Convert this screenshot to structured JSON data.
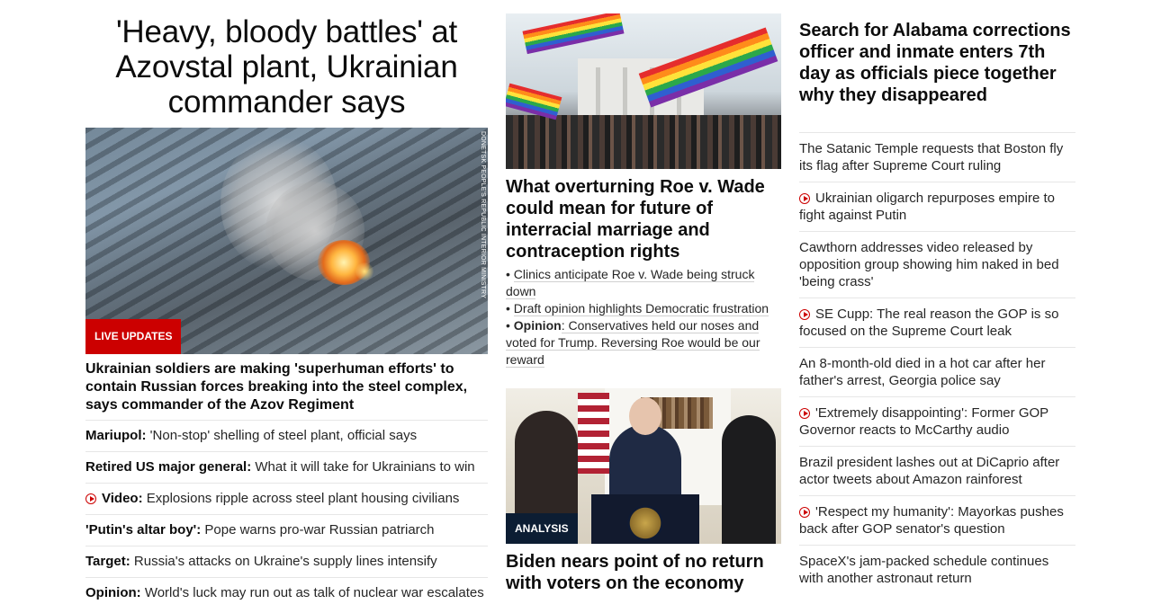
{
  "left": {
    "main_headline": "'Heavy, bloody battles' at Azovstal plant, Ukrainian commander says",
    "image_credit": "DONETSK PEOPLE'S REPUBLIC INTERIOR MINISTRY",
    "badge": "LIVE UPDATES",
    "card_title": "Ukrainian soldiers are making 'superhuman efforts' to contain Russian forces breaking into the steel complex, says commander of the Azov Regiment",
    "items": [
      {
        "bold": "Mariupol:",
        "text": " 'Non-stop' shelling of steel plant, official says",
        "video": false
      },
      {
        "bold": "Retired US major general:",
        "text": " What it will take for Ukrainians to win",
        "video": false
      },
      {
        "bold": "Video:",
        "text": " Explosions ripple across steel plant housing civilians",
        "video": true
      },
      {
        "bold": "'Putin's altar boy':",
        "text": " Pope warns pro-war Russian patriarch",
        "video": false
      },
      {
        "bold": "Target:",
        "text": " Russia's attacks on Ukraine's supply lines intensify",
        "video": false
      },
      {
        "bold": "Opinion:",
        "text": " World's luck may run out as talk of nuclear war escalates",
        "video": false
      }
    ]
  },
  "middle": {
    "story1": {
      "title": "What overturning Roe v. Wade could mean for future of interracial marriage and contraception rights",
      "bullets": [
        {
          "bold": "",
          "text": "Clinics anticipate Roe v. Wade being struck down"
        },
        {
          "bold": "",
          "text": "Draft opinion highlights Democratic frustration"
        },
        {
          "bold": "Opinion",
          "text": ": Conservatives held our noses and voted for Trump. Reversing Roe would be our reward"
        }
      ]
    },
    "story2": {
      "badge": "ANALYSIS",
      "title": "Biden nears point of no return with voters on the economy"
    }
  },
  "right": {
    "headline": "Search for Alabama corrections officer and inmate enters 7th day as officials piece together why they disappeared",
    "items": [
      {
        "text": "The Satanic Temple requests that Boston fly its flag after Supreme Court ruling",
        "video": false
      },
      {
        "text": "Ukrainian oligarch repurposes empire to fight against Putin",
        "video": true
      },
      {
        "text": "Cawthorn addresses video released by opposition group showing him naked in bed 'being crass'",
        "video": false
      },
      {
        "text": "SE Cupp: The real reason the GOP is so focused on the Supreme Court leak",
        "video": true
      },
      {
        "text": "An 8-month-old died in a hot car after her father's arrest, Georgia police say",
        "video": false
      },
      {
        "text": "'Extremely disappointing': Former GOP Governor reacts to McCarthy audio",
        "video": true
      },
      {
        "text": "Brazil president lashes out at DiCaprio after actor tweets about Amazon rainforest",
        "video": false
      },
      {
        "text": "'Respect my humanity': Mayorkas pushes back after GOP senator's question",
        "video": true
      },
      {
        "text": "SpaceX's jam-packed schedule continues with another astronaut return",
        "video": false
      }
    ]
  },
  "colors": {
    "accent_red": "#cc0000",
    "analysis_navy": "#0c1d33",
    "text": "#0c0c0c",
    "divider": "#e6e6e6"
  }
}
